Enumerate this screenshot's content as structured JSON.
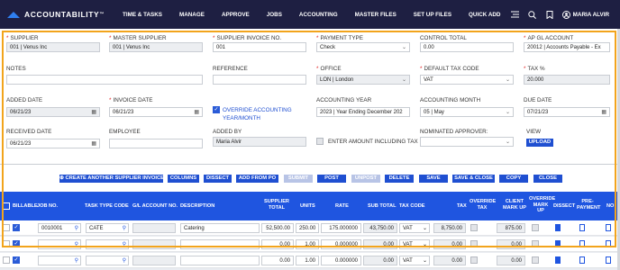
{
  "app": {
    "brand": "ACCOUNTABILITY",
    "brand_tm": "™"
  },
  "nav": {
    "items": [
      "TIME & TASKS",
      "MANAGE",
      "APPROVE",
      "JOBS",
      "ACCOUNTING",
      "MASTER FILES",
      "SET UP FILES",
      "QUICK ADD"
    ],
    "user": "MARIA ALVIR",
    "icons": [
      "menu-icon",
      "search-icon",
      "bookmark-icon",
      "user-icon"
    ]
  },
  "form": {
    "supplier": {
      "label": "SUPPLIER",
      "value": "001 | Venus Inc"
    },
    "master_supplier": {
      "label": "MASTER SUPPLIER",
      "value": "001 | Venus Inc"
    },
    "supplier_invoice": {
      "label": "SUPPLIER INVOICE NO.",
      "value": "001"
    },
    "payment_type": {
      "label": "PAYMENT TYPE",
      "value": "Check"
    },
    "control_total": {
      "label": "CONTROL TOTAL",
      "value": "0.00"
    },
    "ap_gl_account": {
      "label": "AP GL ACCOUNT",
      "value": "20012 | Accounts Payable - Ex"
    },
    "notes": {
      "label": "NOTES",
      "value": ""
    },
    "reference": {
      "label": "REFERENCE",
      "value": ""
    },
    "office": {
      "label": "OFFICE",
      "value": "LON | London"
    },
    "default_tax_code": {
      "label": "DEFAULT TAX CODE",
      "value": "VAT"
    },
    "tax_pct": {
      "label": "TAX %",
      "value": "20.000"
    },
    "added_date": {
      "label": "ADDED DATE",
      "value": "06/21/23"
    },
    "invoice_date": {
      "label": "INVOICE DATE",
      "value": "06/21/23"
    },
    "override_accounting": {
      "label_line1": "OVERRIDE ACCOUNTING",
      "label_line2": "YEAR/MONTH",
      "checked": true
    },
    "accounting_year": {
      "label": "ACCOUNTING YEAR",
      "value": "2023 | Year Ending December 202"
    },
    "accounting_month": {
      "label": "ACCOUNTING MONTH",
      "value": "05 | May"
    },
    "due_date": {
      "label": "DUE DATE",
      "value": "07/21/23"
    },
    "received_date": {
      "label": "RECEIVED DATE",
      "value": "06/21/23"
    },
    "employee": {
      "label": "EMPLOYEE",
      "value": ""
    },
    "added_by": {
      "label": "ADDED BY",
      "value": "Maria Alvir"
    },
    "enter_incl_tax": {
      "label": "ENTER AMOUNT INCLUDING TAX",
      "checked": false
    },
    "nominated_approver": {
      "label": "NOMINATED APPROVER:",
      "value": ""
    },
    "view": {
      "label": "VIEW",
      "button": "UPLOAD"
    }
  },
  "actions": [
    {
      "label": "CREATE ANOTHER SUPPLIER INVOICE",
      "enabled": true,
      "plus": true
    },
    {
      "label": "COLUMNS",
      "enabled": true
    },
    {
      "label": "DISSECT",
      "enabled": true
    },
    {
      "label": "ADD FROM PO",
      "enabled": true
    },
    {
      "label": "SUBMIT",
      "enabled": false
    },
    {
      "label": "POST",
      "enabled": true
    },
    {
      "label": "UNPOST",
      "enabled": false
    },
    {
      "label": "DELETE",
      "enabled": true
    },
    {
      "label": "SAVE",
      "enabled": true
    },
    {
      "label": "SAVE & CLOSE",
      "enabled": true
    },
    {
      "label": "COPY",
      "enabled": true
    },
    {
      "label": "CLOSE",
      "enabled": true
    }
  ],
  "table": {
    "headers": {
      "billable": "BILLABLE",
      "job_no": "JOB NO.",
      "task_type": "TASK TYPE CODE",
      "gl_account": "G/L ACCOUNT NO.",
      "description": "DESCRIPTION",
      "supplier_total_1": "SUPPLIER",
      "supplier_total_2": "TOTAL",
      "units": "UNITS",
      "rate": "RATE",
      "sub_total": "SUB TOTAL",
      "tax_code": "TAX CODE",
      "tax": "TAX",
      "override_tax_1": "OVERRIDE",
      "override_tax_2": "TAX",
      "client_markup_1": "CLIENT",
      "client_markup_2": "MARK UP",
      "override_markup_1": "OVERRIDE",
      "override_markup_2": "MARK",
      "override_markup_3": "UP",
      "dissect": "DISSECT",
      "prepayment_1": "PRE-",
      "prepayment_2": "PAYMENT",
      "no": "NO"
    },
    "rows": [
      {
        "job": "0010001",
        "task": "CATE",
        "gl": "",
        "desc": "Catering",
        "supplier_total": "52,500.00",
        "units": "250.00",
        "rate": "175.000000",
        "sub_total": "43,750.00",
        "tax_code": "VAT",
        "tax": "8,750.00",
        "client_markup": "875.00"
      },
      {
        "job": "",
        "task": "",
        "gl": "",
        "desc": "",
        "supplier_total": "0.00",
        "units": "1.00",
        "rate": "0.000000",
        "sub_total": "0.00",
        "tax_code": "VAT",
        "tax": "0.00",
        "client_markup": "0.00"
      },
      {
        "job": "",
        "task": "",
        "gl": "",
        "desc": "",
        "supplier_total": "0.00",
        "units": "1.00",
        "rate": "0.000000",
        "sub_total": "0.00",
        "tax_code": "VAT",
        "tax": "0.00",
        "client_markup": "0.00"
      }
    ]
  },
  "colors": {
    "nav_bg": "#1e1f42",
    "accent": "#1f55e0",
    "highlight": "#f2a41c",
    "required": "#e02020"
  }
}
